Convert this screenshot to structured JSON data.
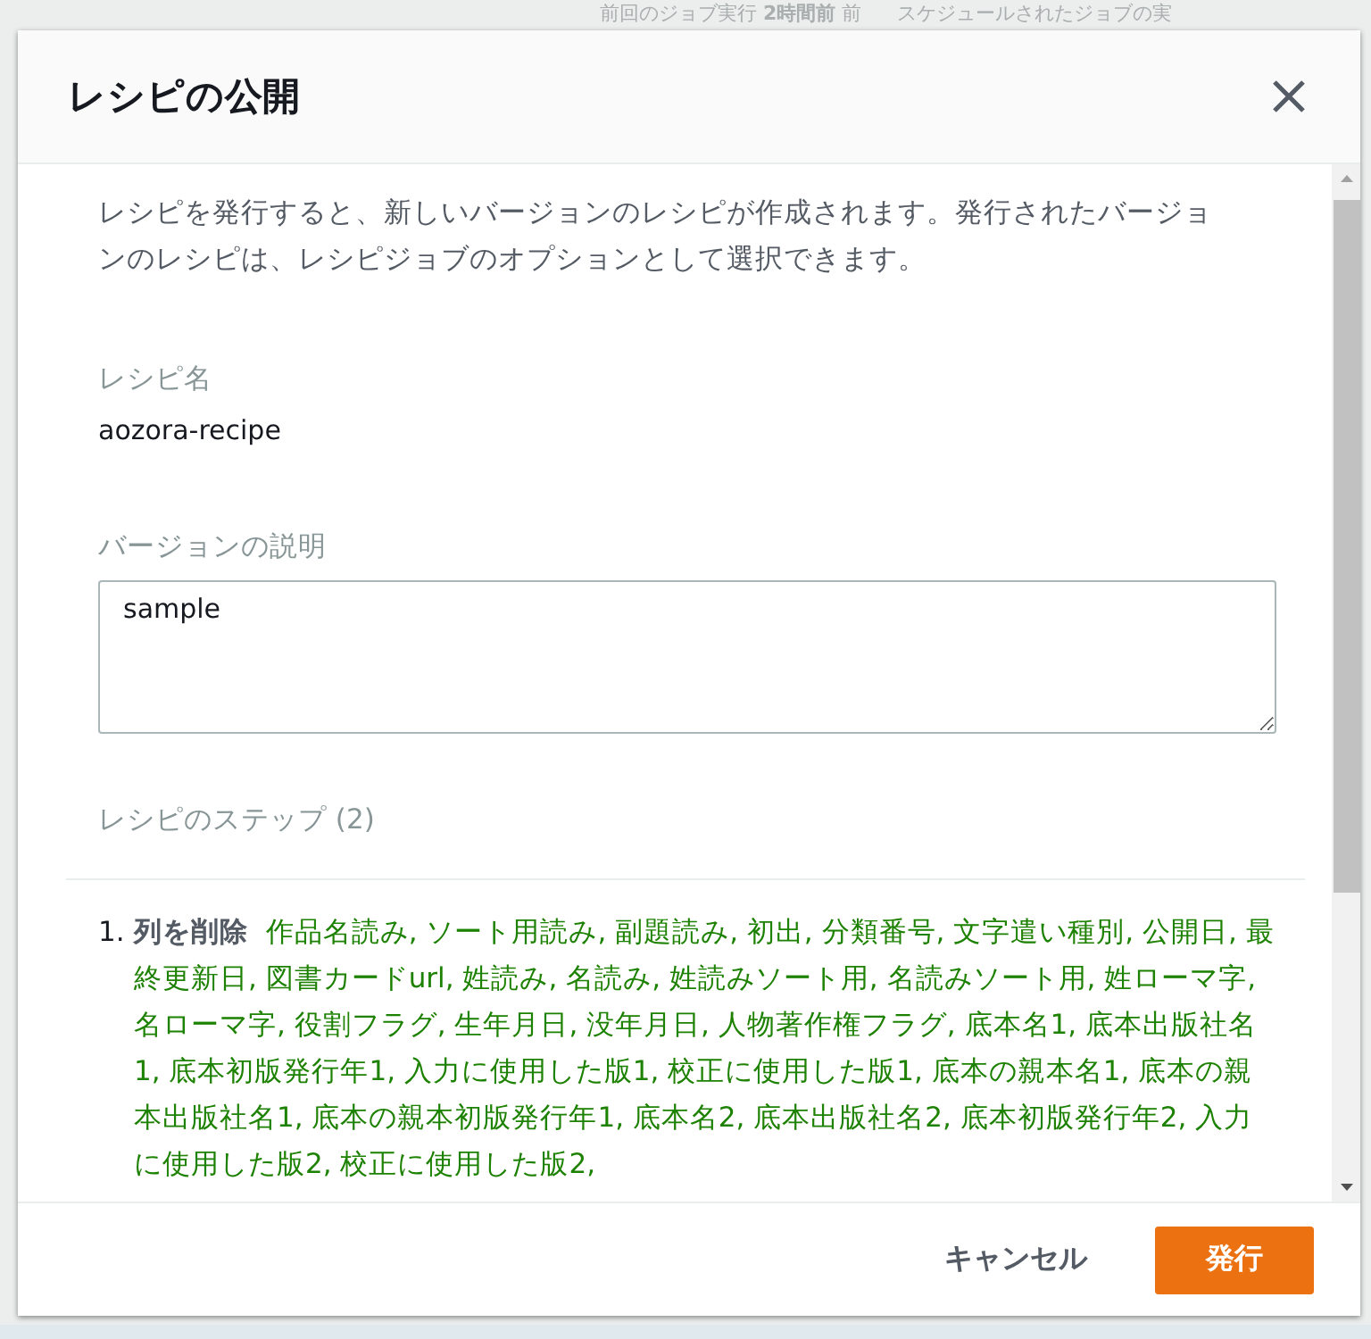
{
  "background_page": {
    "status_text": "前回のジョブ実行 **2時間前** 前",
    "schedule_text": "スケジュールされたジョブの実"
  },
  "dialog": {
    "title": "レシピの公開",
    "description": "レシピを発行すると、新しいバージョンのレシピが作成されます。発行されたバージョンのレシピは、レシピジョブのオプションとして選択できます。",
    "recipe_name": {
      "label": "レシピ名",
      "value": "aozora-recipe"
    },
    "version_description": {
      "label": "バージョンの説明",
      "value": "sample"
    },
    "steps": {
      "heading": "レシピのステップ (2)",
      "items": [
        {
          "number": "1.",
          "action": "列を削除",
          "columns": "作品名読み, ソート用読み, 副題読み, 初出, 分類番号, 文字遣い種別, 公開日, 最終更新日, 図書カードurl, 姓読み, 名読み, 姓読みソート用, 名読みソート用, 姓ローマ字, 名ローマ字, 役割フラグ, 生年月日, 没年月日, 人物著作権フラグ, 底本名1, 底本出版社名1, 底本初版発行年1, 入力に使用した版1, 校正に使用した版1, 底本の親本名1, 底本の親本出版社名1, 底本の親本初版発行年1, 底本名2, 底本出版社名2, 底本初版発行年2, 入力に使用した版2, 校正に使用した版2,"
        }
      ]
    },
    "buttons": [
      {
        "label": "キャンセル",
        "kind": "link"
      },
      {
        "label": "発行",
        "kind": "primary"
      }
    ]
  }
}
